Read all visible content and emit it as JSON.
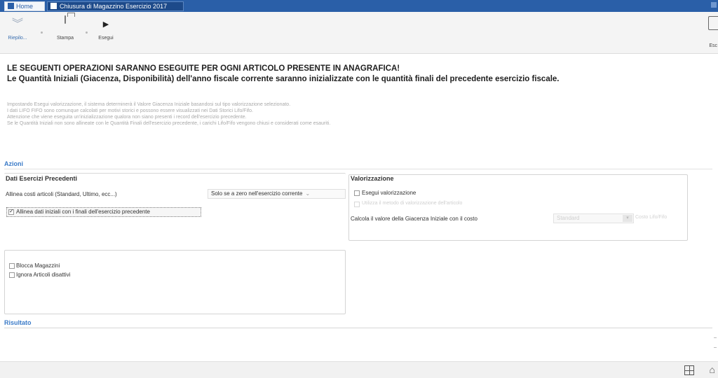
{
  "tabs": {
    "home": "Home",
    "document": "Chiusura di Magazzino Esercizio 2017"
  },
  "ribbon": {
    "riepilogo": "Riepilo...",
    "stampa": "Stampa",
    "esegui": "Esegui",
    "exit": "Esc"
  },
  "warning": {
    "line1": "LE SEGUENTI OPERAZIONI SARANNO ESEGUITE PER OGNI ARTICOLO PRESENTE IN ANAGRAFICA!",
    "line2": "Le Quantità Iniziali (Giacenza, Disponibilità) dell'anno fiscale corrente saranno inizializzate con le quantità finali del precedente esercizio fiscale."
  },
  "info": {
    "line1": "Impostando Esegui valorizzazione, il sistema determinerà il Valore Giacenza Iniziale basandosi sul tipo valorizzazione selezionato.",
    "line2": "I dati LIFO FIFO sono comunque calcolati per motivi storici e possono essere visualizzati nei Dati Storici Lifo/Fifo.",
    "line3": "Attenzione che viene eseguita un'inizializzazione qualora non siano presenti i record dell'esercizio precedente.",
    "line4": "Se le Quantità Iniziali non sono allineate con le Quantità Finali dell'esercizio precedente, i carichi Lifo/Fifo vengono chiusi e considerati come esauriti."
  },
  "azioni": {
    "title": "Azioni",
    "dati_esercizi": {
      "title": "Dati Esercizi Precedenti",
      "allinea_costi_label": "Allinea costi articoli (Standard, Ultimo, ecc...)",
      "allinea_costi_value": "Solo se a zero nell'esercizio corrente",
      "allinea_dati_label": "Allinea dati iniziali con i finali dell'esercizio precedente",
      "allinea_dati_checked": true
    },
    "valorizzazione": {
      "title": "Valorizzazione",
      "esegui_label": "Esegui valorizzazione",
      "esegui_checked": false,
      "disabled_option_label": "Utilizza il metodo di valorizzazione dell'articolo",
      "calcola_label": "Calcola il valore della Giacenza Iniziale con il costo",
      "calcola_value": "Standard",
      "calcola_extra": "Costo Lifo/Fifo"
    },
    "opzioni": {
      "blocca_label": "Blocca Magazzini",
      "ignora_label": "Ignora Articoli disattivi"
    }
  },
  "risultato": {
    "title": "Risultato"
  }
}
